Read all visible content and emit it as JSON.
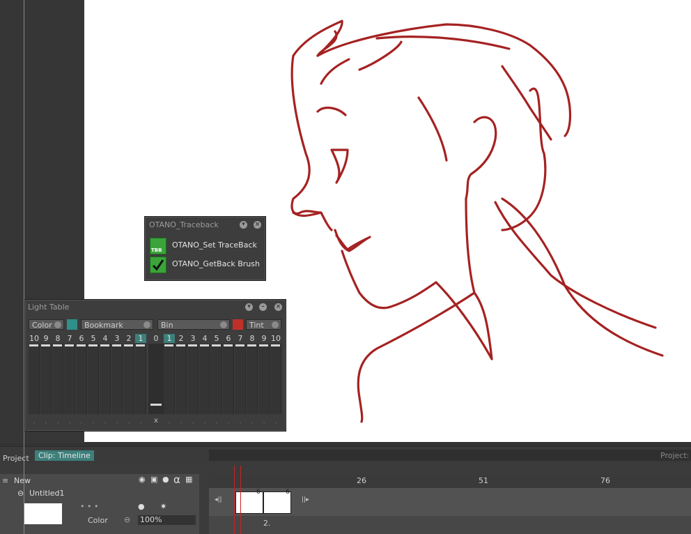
{
  "traceback_panel": {
    "title": "OTANO_Traceback",
    "items": [
      {
        "label": "OTANO_Set TraceBack",
        "icon": "tbb-icon",
        "icon_text": "TBB"
      },
      {
        "label": "OTANO_GetBack Brush",
        "icon": "checkmark-icon"
      }
    ]
  },
  "light_table": {
    "title": "Light Table",
    "color_label": "Color",
    "bookmark_label": "Bookmark",
    "bin_label": "Bin",
    "tint_label": "Tint",
    "color_swatch": "#2f8f8b",
    "bin_swatch": "#c0302a",
    "left_numbers": [
      "10",
      "9",
      "8",
      "7",
      "6",
      "5",
      "4",
      "3",
      "2",
      "1"
    ],
    "center_number": "0",
    "right_numbers": [
      "1",
      "2",
      "3",
      "4",
      "5",
      "6",
      "7",
      "8",
      "9",
      "10"
    ],
    "center_mark": "x"
  },
  "timeline": {
    "tab_project": "Project",
    "tab_clip": "Clip: Timeline",
    "right_label": "Project:",
    "layer_new": "New",
    "layer_name": "Untitled1",
    "color_label": "Color",
    "opacity_value": "100%",
    "ruler_marks": [
      "26",
      "51",
      "76"
    ],
    "frame_counts": [
      "6",
      "6"
    ],
    "frame_marker": "2."
  },
  "colors": {
    "stroke": "#a52222",
    "accent": "#3d7f7b"
  }
}
